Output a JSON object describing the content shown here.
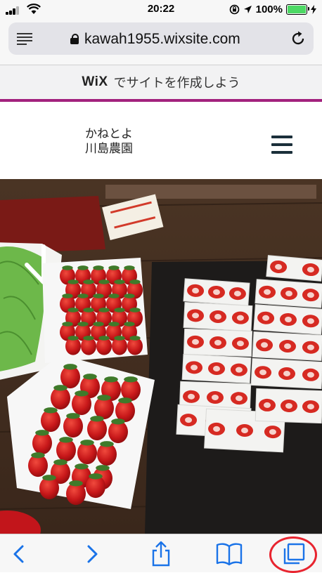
{
  "status_bar": {
    "time": "20:22",
    "battery_percent": "100%",
    "battery_level": 1.0,
    "battery_color": "#4cd964"
  },
  "browser": {
    "url": "kawah1955.wixsite.com",
    "icons": [
      "reader-icon",
      "lock-icon",
      "reload-icon"
    ]
  },
  "wix_banner": {
    "logo": "WiX",
    "text": "でサイトを作成しよう",
    "accent_color": "#a2217d"
  },
  "site": {
    "name_line1": "かねとよ",
    "name_line2": "川島農園",
    "menu_icon": "hamburger-menu-icon"
  },
  "toolbar": {
    "icons": [
      "back-icon",
      "forward-icon",
      "share-icon",
      "bookmarks-icon",
      "tabs-icon"
    ],
    "tint_color": "#1a73e8",
    "highlight_color": "#e8242f"
  }
}
